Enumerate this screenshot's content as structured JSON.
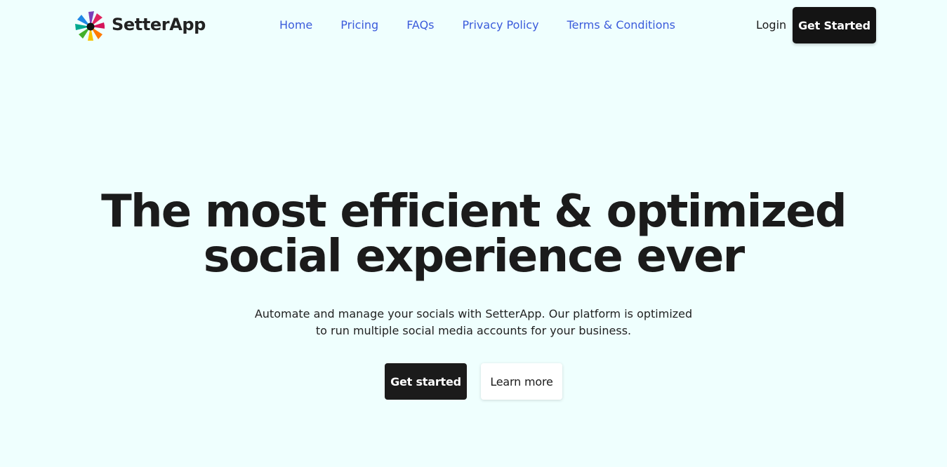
{
  "brand": {
    "name": "SetterApp",
    "logo_icon": "pinwheel-logo-icon",
    "logo_colors": [
      "#e0245e",
      "#7b3fb8",
      "#1e88e5",
      "#00a98f",
      "#43b02a",
      "#f5c400",
      "#ff7a00",
      "#d4145a"
    ]
  },
  "nav": {
    "links": [
      {
        "label": "Home"
      },
      {
        "label": "Pricing"
      },
      {
        "label": "FAQs"
      },
      {
        "label": "Privacy Policy"
      },
      {
        "label": "Terms & Conditions"
      }
    ],
    "login_label": "Login",
    "get_started_label": "Get Started"
  },
  "hero": {
    "title_line1": "The most efficient & optimized",
    "title_line2": "social experience ever",
    "subtitle_line1": "Automate and manage your socials with SetterApp. Our platform is optimized",
    "subtitle_line2": "to run multiple social media accounts for your business.",
    "primary_cta": "Get started",
    "secondary_cta": "Learn more"
  },
  "colors": {
    "background": "#effffe",
    "nav_link": "#3b5bdb",
    "dark_button": "#141414"
  }
}
